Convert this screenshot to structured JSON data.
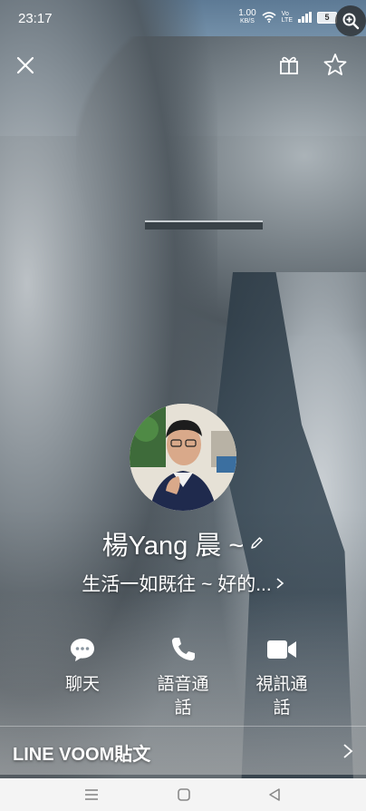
{
  "status_bar": {
    "time": "23:17",
    "net_speed": "1.00",
    "net_unit": "KB/S",
    "battery": "5"
  },
  "profile": {
    "name": "楊Yang 晨 ~",
    "status_message": "生活一如既往 ~ 好的..."
  },
  "actions": [
    {
      "label": "聊天",
      "icon": "chat-icon"
    },
    {
      "label": "語音通\n話",
      "icon": "phone-icon"
    },
    {
      "label": "視訊通\n話",
      "icon": "video-icon"
    }
  ],
  "voom": {
    "title": "LINE VOOM貼文"
  },
  "icons": {
    "close": "close-icon",
    "gift": "gift-icon",
    "star": "star-icon",
    "edit": "pencil-icon",
    "zoom": "zoom-in-icon"
  }
}
